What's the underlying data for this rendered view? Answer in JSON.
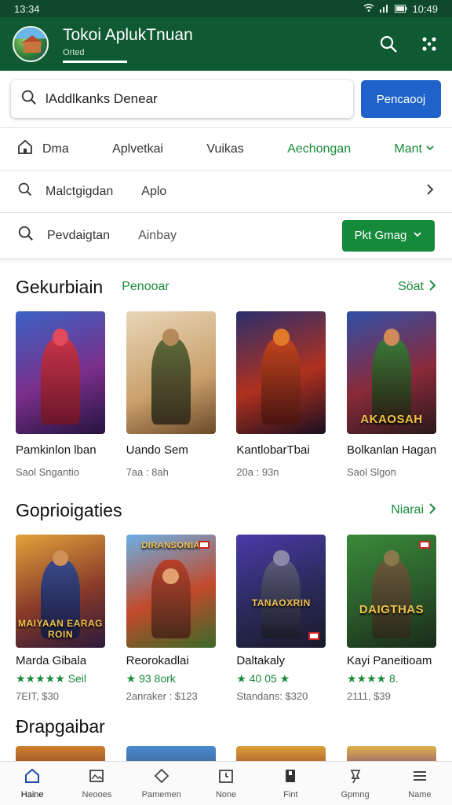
{
  "status": {
    "time_left": "13:34",
    "time_right": "10:49"
  },
  "appbar": {
    "title": "Tokoi AplukTnuan",
    "subtitle": "Orted"
  },
  "search": {
    "placeholder": "lAddlkanks Denear",
    "value": "lAddlkanks Denear",
    "button_label": "Pencaooj"
  },
  "filters": {
    "row1": [
      "Dma",
      "Aplvetkai",
      "Vuikas",
      "Aechongan",
      "Mant"
    ],
    "row2": [
      "Malctgigdan",
      "Aplo"
    ],
    "row3": [
      "Pevdaigtan",
      "Ainbay"
    ],
    "filter_button": "Pkt Gmag"
  },
  "section1": {
    "title": "Gekurbiain",
    "tag": "Penooar",
    "more": "Söat",
    "cards": [
      {
        "name": "Pamkinlon lban",
        "sub": "Saol Sngantio",
        "label": ""
      },
      {
        "name": "Uando Sem",
        "sub": "7aa : 8ah",
        "label": ""
      },
      {
        "name": "KantlobarTbai",
        "sub": "20a : 93n",
        "label": ""
      },
      {
        "name": "Bolkanlan Hagan",
        "sub": "Saol Slgon",
        "label": "AKAOSAH"
      }
    ]
  },
  "section2": {
    "title": "Goprioigaties",
    "more": "Niarai",
    "cards": [
      {
        "name": "Marda Gibala",
        "stars": "★★★★★ Seil",
        "sub": "7EIT, $30",
        "label": "MAIYAAN EARAG ROIN"
      },
      {
        "name": "Reorokadlai",
        "stars": "★ 93 8ork",
        "sub": "2anraker : $123",
        "label": "DIRANSONIA"
      },
      {
        "name": "Daltakaly",
        "stars": "★ 40 05 ★",
        "sub": "Standans: $320",
        "label": "TANAOXRIN"
      },
      {
        "name": "Kayi Paneitioam",
        "stars": "★★★★ 8.",
        "sub": "2111, $39",
        "label": "DAIGTHAS"
      }
    ]
  },
  "section3": {
    "title": "Đrapgaibar"
  },
  "nav": [
    {
      "label": "Haine",
      "icon": "home-icon"
    },
    {
      "label": "Neooes",
      "icon": "image-icon"
    },
    {
      "label": "Pamemen",
      "icon": "diamond-icon"
    },
    {
      "label": "None",
      "icon": "calendar-icon"
    },
    {
      "label": "Fint",
      "icon": "bookmark-icon"
    },
    {
      "label": "Gpmng",
      "icon": "pin-icon"
    },
    {
      "label": "Name",
      "icon": "menu-icon"
    }
  ],
  "colors": {
    "brand": "#0f5a32",
    "accent": "#188a3a",
    "button_blue": "#1f62c9"
  }
}
